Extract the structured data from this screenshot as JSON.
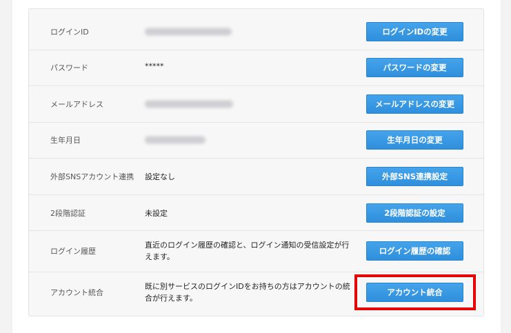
{
  "rows": [
    {
      "label": "ログインID",
      "value": "",
      "button": "ログインIDの変更"
    },
    {
      "label": "パスワード",
      "value": "*****",
      "button": "パスワードの変更"
    },
    {
      "label": "メールアドレス",
      "value": "",
      "button": "メールアドレスの変更"
    },
    {
      "label": "生年月日",
      "value": "",
      "button": "生年月日の変更"
    },
    {
      "label": "外部SNSアカウント連携",
      "value": "設定なし",
      "button": "外部SNS連携設定"
    },
    {
      "label": "2段階認証",
      "value": "未設定",
      "button": "2段階認証の設定"
    },
    {
      "label": "ログイン履歴",
      "value": "直近のログイン履歴の確認と、ログイン通知の受信設定が行えます。",
      "button": "ログイン履歴の確認"
    },
    {
      "label": "アカウント統合",
      "value": "既に別サービスのログインIDをお持ちの方はアカウントの統合が行えます。",
      "button": "アカウント統合"
    }
  ],
  "colors": {
    "button": "#3a9be6",
    "highlight": "#e60000"
  }
}
